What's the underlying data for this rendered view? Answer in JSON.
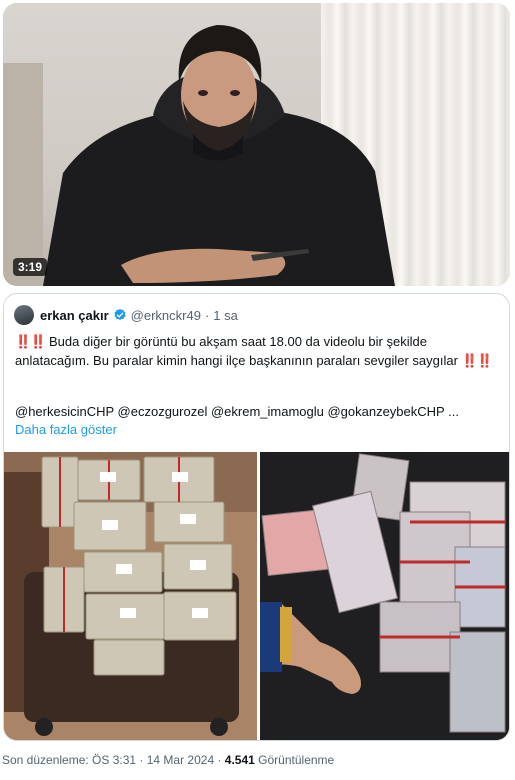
{
  "video": {
    "duration": "3:19"
  },
  "quoted_tweet": {
    "author_name": "erkan çakır",
    "author_handle": "@erknckr49",
    "time": "1 sa",
    "text_prefix": "‼️‼️",
    "text": " Buda diğer bir görüntü bu akşam saat 18.00 da videolu bir şekilde anlatacağım. Bu paralar kimin hangi ilçe başkanının paraları sevgiler saygılar ",
    "text_suffix": "‼️‼️",
    "mentions": "@herkesicinCHP @eczozgurozel @ekrem_imamoglu @gokanzeybekCHP ...",
    "show_more": "Daha fazla göster"
  },
  "footer": {
    "edited_label": "Son düzenleme: ÖS 3:31 · 14 Mar 2024 · ",
    "views_count": "4.541",
    "views_label": " Görüntülenme"
  },
  "colors": {
    "link": "#1d9bf0",
    "verified": "#1d9bf0",
    "muted": "#536471",
    "emoji": "#d9121f"
  }
}
